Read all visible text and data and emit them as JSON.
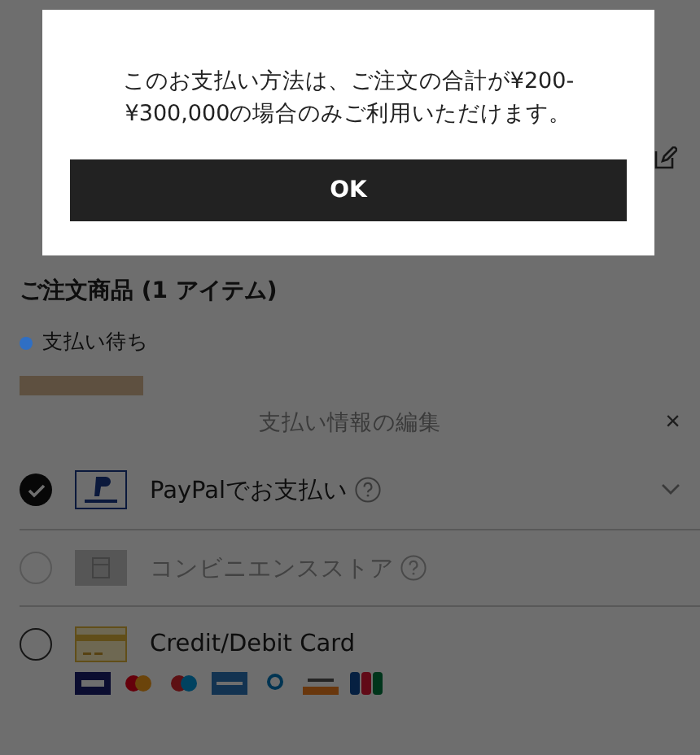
{
  "order_section": {
    "heading": "ご注文商品 (1 アイテム)",
    "status": {
      "label": "支払い待ち",
      "color": "#2f6fc4"
    }
  },
  "payment_sheet": {
    "title": "支払い情報の編集",
    "close": "×",
    "methods": [
      {
        "kind": "paypal",
        "label": "PayPalでお支払い",
        "selected": true,
        "disabled": false,
        "help": true,
        "expandable": true
      },
      {
        "kind": "store",
        "label": "コンビニエンスストア",
        "selected": false,
        "disabled": true,
        "help": true,
        "expandable": false
      },
      {
        "kind": "card",
        "label": "Credit/Debit Card",
        "selected": false,
        "disabled": false,
        "help": false,
        "expandable": false,
        "brands": [
          {
            "kind": "visa"
          },
          {
            "kind": "mastercard"
          },
          {
            "kind": "maestro"
          },
          {
            "kind": "amex"
          },
          {
            "kind": "diners"
          },
          {
            "kind": "discover"
          },
          {
            "kind": "jcb"
          }
        ]
      }
    ]
  },
  "dialog": {
    "message": "このお支払い方法は、ご注文の合計が¥200-¥300,000の場合のみご利用いただけます。",
    "button": "OK"
  }
}
